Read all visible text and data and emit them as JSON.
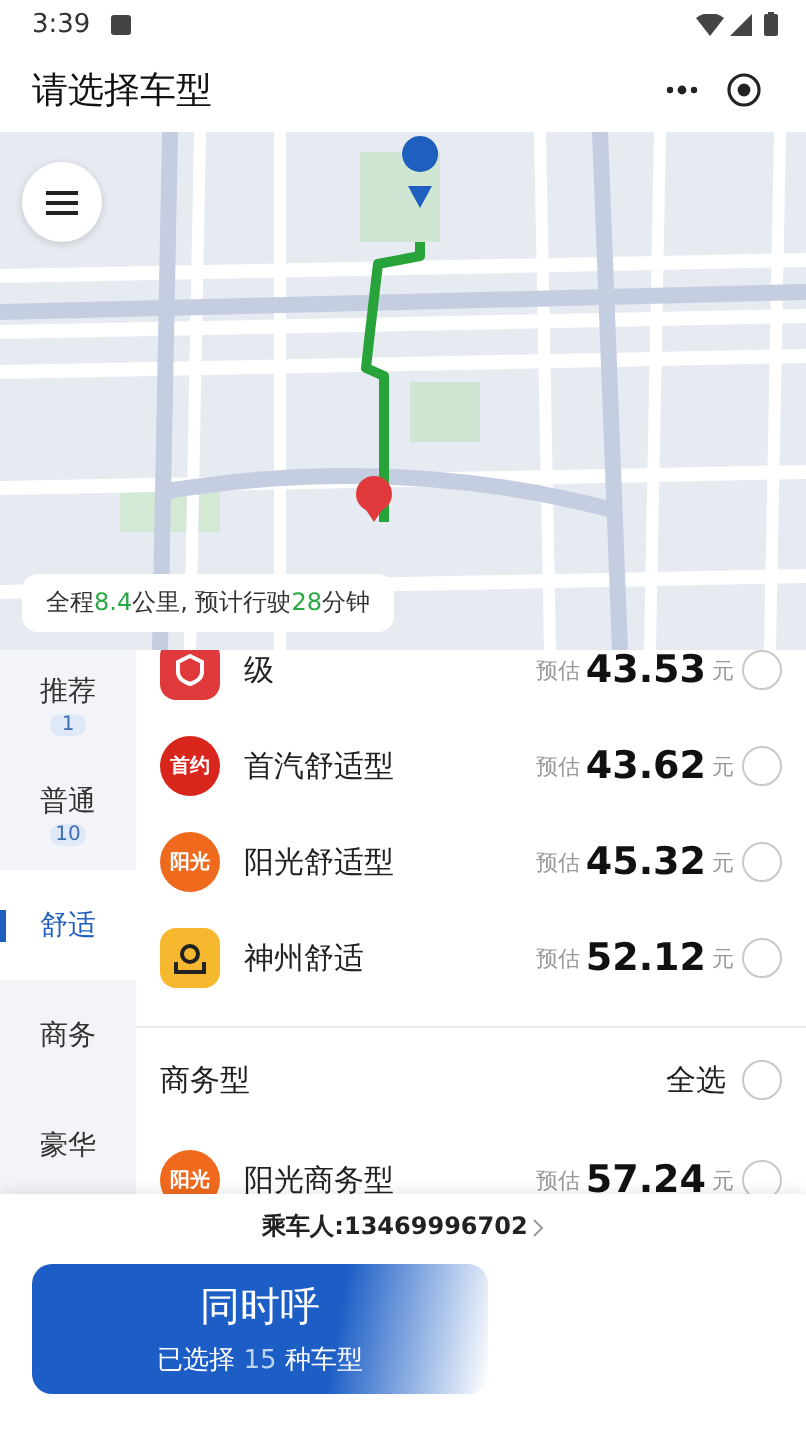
{
  "status_bar": {
    "time": "3:39"
  },
  "title_bar": {
    "title": "请选择车型"
  },
  "map": {
    "route_summary": [
      {
        "text": "全程",
        "highlight": false
      },
      {
        "text": "8.4",
        "highlight": true
      },
      {
        "text": "公里, 预计行驶",
        "highlight": false
      },
      {
        "text": "28",
        "highlight": true
      },
      {
        "text": "分钟",
        "highlight": false
      }
    ]
  },
  "sidebar": {
    "items": [
      {
        "label": "推荐",
        "count": "1",
        "selected": false
      },
      {
        "label": "普通",
        "count": "10",
        "selected": false
      },
      {
        "label": "舒适",
        "selected": true
      },
      {
        "label": "商务",
        "selected": false
      },
      {
        "label": "豪华",
        "selected": false
      }
    ]
  },
  "car_list": {
    "rows": [
      {
        "kind": "car",
        "logo": {
          "kind": "shield",
          "color": "#e0393b"
        },
        "name": "级",
        "estimate_label": "预估",
        "price": "43.53",
        "unit": "元",
        "selected": false
      },
      {
        "kind": "car",
        "logo": {
          "kind": "text",
          "text": "首约",
          "color": "#d9261c"
        },
        "name": "首汽舒适型",
        "estimate_label": "预估",
        "price": "43.62",
        "unit": "元",
        "selected": false
      },
      {
        "kind": "car",
        "logo": {
          "kind": "text",
          "text": "阳光",
          "color": "#f06a1d"
        },
        "name": "阳光舒适型",
        "estimate_label": "预估",
        "price": "45.32",
        "unit": "元",
        "selected": false
      },
      {
        "kind": "car",
        "logo": {
          "kind": "pin",
          "color": "#f5b82e"
        },
        "name": "神州舒适",
        "estimate_label": "预估",
        "price": "52.12",
        "unit": "元",
        "selected": false
      },
      {
        "kind": "section",
        "title": "商务型",
        "action": "全选",
        "selected": false
      },
      {
        "kind": "car",
        "logo": {
          "kind": "text",
          "text": "阳光",
          "color": "#f06a1d"
        },
        "name": "阳光商务型",
        "estimate_label": "预估",
        "price": "57.24",
        "unit": "元",
        "selected": false
      }
    ]
  },
  "bottom_sheet": {
    "passenger": "乘车人:13469996702",
    "call_button": {
      "title": "同时呼",
      "subtitle": [
        {
          "text": "已选择 ",
          "highlight": false
        },
        {
          "text": "15",
          "highlight": true
        },
        {
          "text": " 种车型",
          "highlight": false
        }
      ]
    }
  }
}
